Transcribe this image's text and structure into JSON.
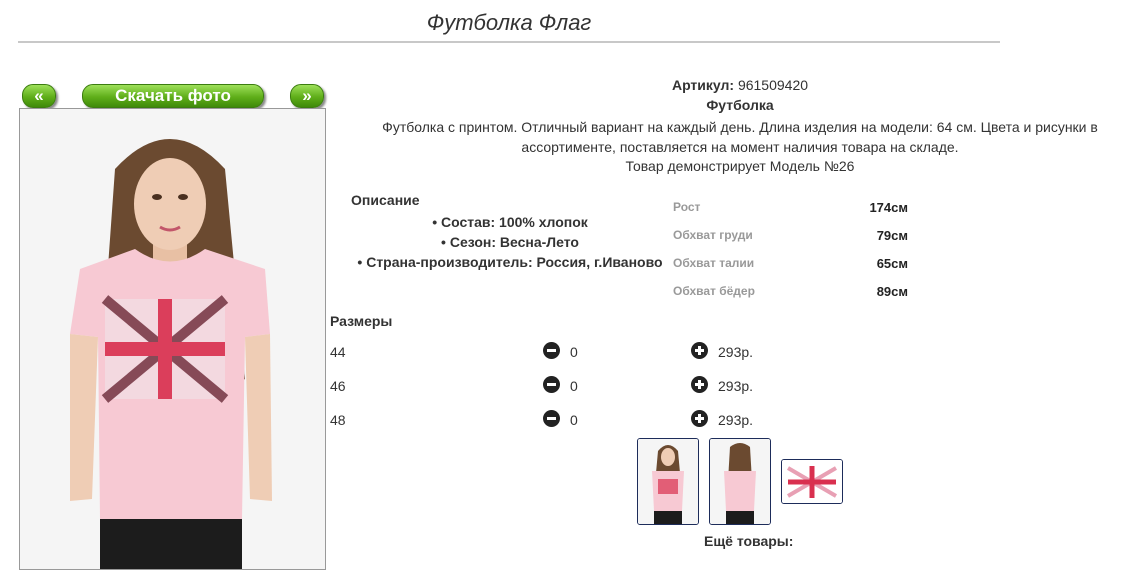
{
  "page": {
    "title": "Футболка Флаг"
  },
  "gallery": {
    "prev_label": "«",
    "next_label": "»",
    "download_label": "Скачать фото"
  },
  "product": {
    "article_label": "Артикул:",
    "article_value": "961509420",
    "type": "Футболка",
    "description": "Футболка с принтом. Отличный вариант на каждый день. Длина изделия на модели: 64 см. Цвета и рисунки в ассортименте, поставляется на момент наличия товара на складе.",
    "model_note": "Товар демонстрирует Модель №26"
  },
  "description_block": {
    "heading": "Описание",
    "items": [
      "Состав: 100% хлопок",
      "Сезон: Весна-Лето",
      "Страна-производитель: Россия, г.Иваново"
    ]
  },
  "measurements": [
    {
      "label": "Рост",
      "value": "174см"
    },
    {
      "label": "Обхват груди",
      "value": "79см"
    },
    {
      "label": "Обхват талии",
      "value": "65см"
    },
    {
      "label": "Обхват бёдер",
      "value": "89см"
    }
  ],
  "sizes": {
    "heading": "Размеры",
    "rows": [
      {
        "size": "44",
        "qty": "0",
        "price": "293р."
      },
      {
        "size": "46",
        "qty": "0",
        "price": "293р."
      },
      {
        "size": "48",
        "qty": "0",
        "price": "293р."
      }
    ]
  },
  "more_products": "Ещё товары:",
  "colors": {
    "button_green": "#5fae19",
    "shirt_pink": "#f7c9d3",
    "print_red": "#d9304f",
    "thumb_border": "#1d2c5a"
  }
}
